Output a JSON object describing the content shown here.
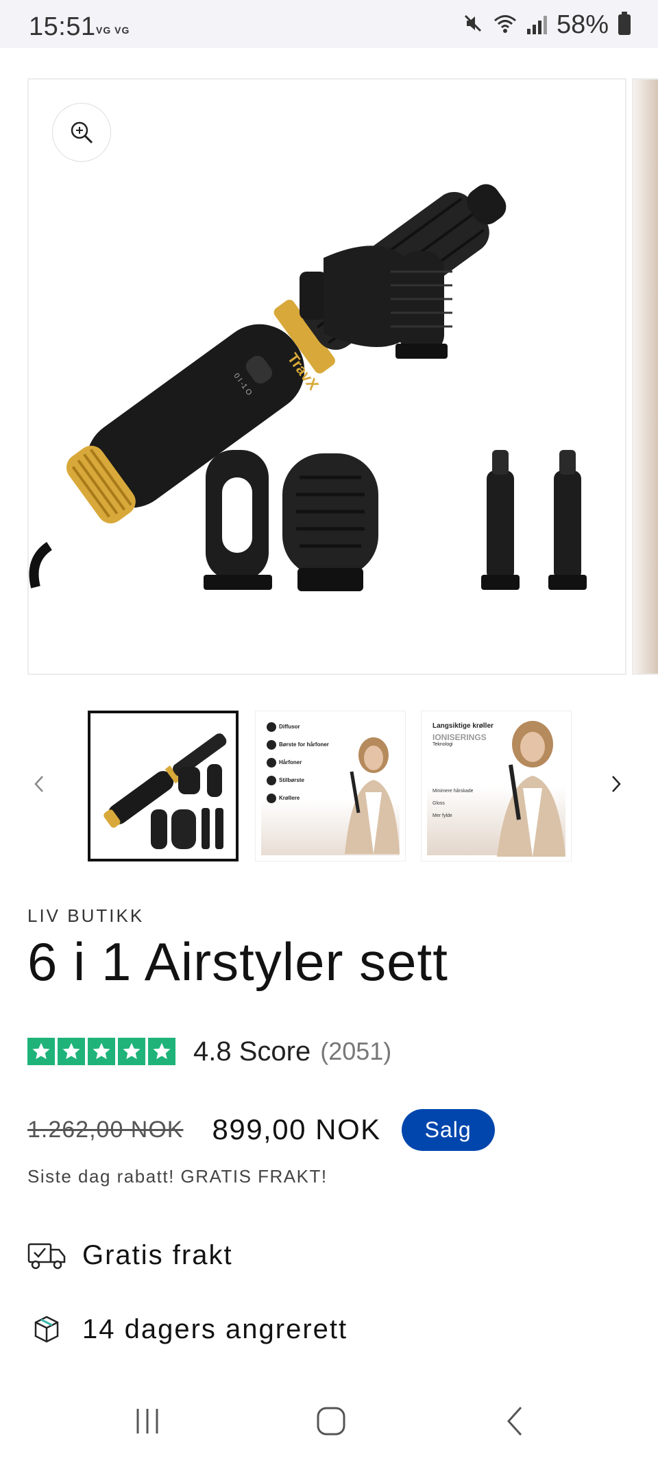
{
  "status_bar": {
    "time": "15:51",
    "carriers": "VG VG",
    "battery_percent": "58%",
    "icons": [
      "mute-icon",
      "wifi-icon",
      "signal-icon",
      "battery-icon"
    ]
  },
  "gallery": {
    "zoom_icon": "zoom-in-icon",
    "main_image_brand": "TravX",
    "main_image_button_text": "0 I -1 O",
    "thumbnails": [
      {
        "name": "airstyler-set-photo",
        "active": true
      },
      {
        "name": "attachments-infographic",
        "items": [
          "Diffusor",
          "Børste for hårfoner",
          "Hårfoner",
          "Stilbørste",
          "Krøllere"
        ]
      },
      {
        "name": "ionic-technology-infographic",
        "headline": "Langsiktige krøller",
        "highlight": "IONISERINGS",
        "sub": "Teknologi",
        "items": [
          "Minimere hårskade",
          "Gloss",
          "Mer fylde"
        ]
      }
    ],
    "prev_icon": "chevron-left-icon",
    "next_icon": "chevron-right-icon"
  },
  "product": {
    "vendor": "LIV BUTIKK",
    "title": "6 i 1 Airstyler sett",
    "rating": {
      "stars": 5,
      "score_text": "4.8 Score",
      "count_text": "(2051)",
      "star_color": "#1fb37a"
    },
    "price": {
      "compare_at": "1.262,00 NOK",
      "current": "899,00 NOK",
      "badge": "Salg",
      "badge_color": "#0046ad"
    },
    "promo_text": "Siste dag rabatt! GRATIS FRAKT!",
    "features": [
      {
        "icon": "delivery-truck-icon",
        "label": "Gratis frakt"
      },
      {
        "icon": "package-icon",
        "label": "14 dagers angrerett"
      }
    ]
  },
  "nav_bar": {
    "icons": [
      "recent-apps-icon",
      "home-icon",
      "back-icon"
    ]
  }
}
